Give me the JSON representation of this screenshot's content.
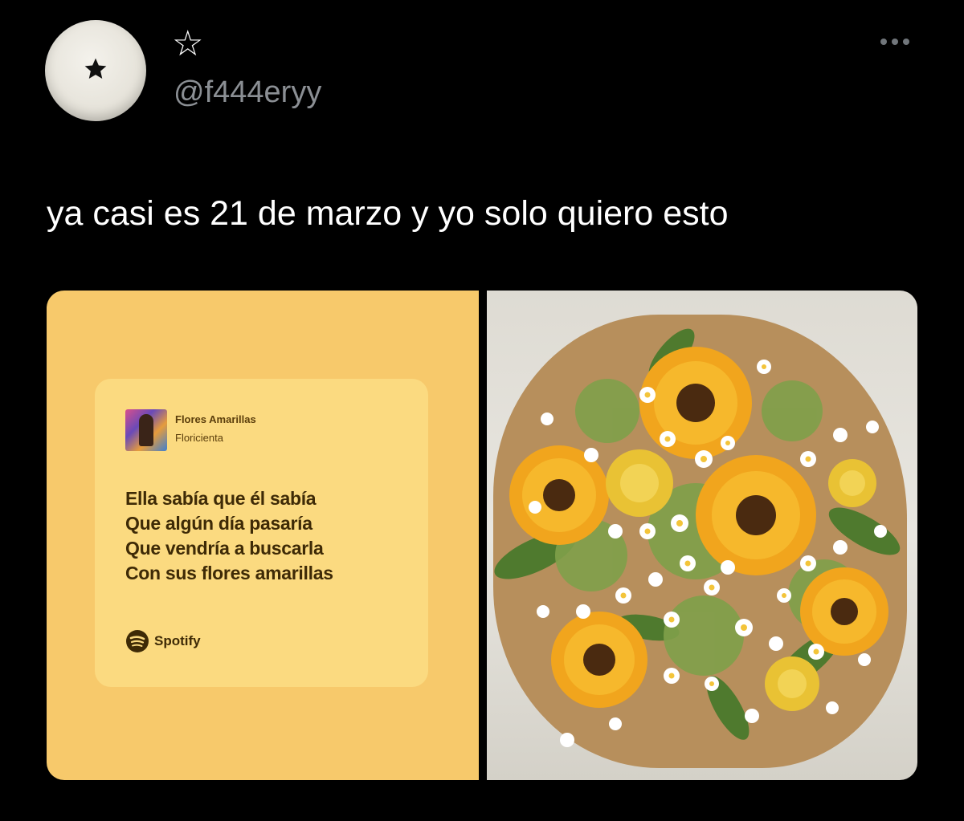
{
  "tweet": {
    "display_name": "☆",
    "handle": "@f444eryy",
    "text": "ya casi es 21 de marzo y yo solo quiero esto",
    "more_icon": "ellipsis-icon"
  },
  "lyric_card": {
    "song_title": "Flores Amarillas",
    "artist": "Floricienta",
    "lyrics": [
      "Ella sabía que él sabía",
      "Que algún día pasaría",
      "Que vendría a buscarla",
      "Con sus flores amarillas"
    ],
    "brand": "Spotify",
    "colors": {
      "panel": "#f7c96b",
      "card": "#fbda80",
      "text": "#3e2a06"
    }
  },
  "photo": {
    "subject_icon": "sunflower-bouquet-image"
  },
  "colors": {
    "background": "#000000",
    "primary_text": "#ffffff",
    "secondary_text": "#8b8f94"
  }
}
